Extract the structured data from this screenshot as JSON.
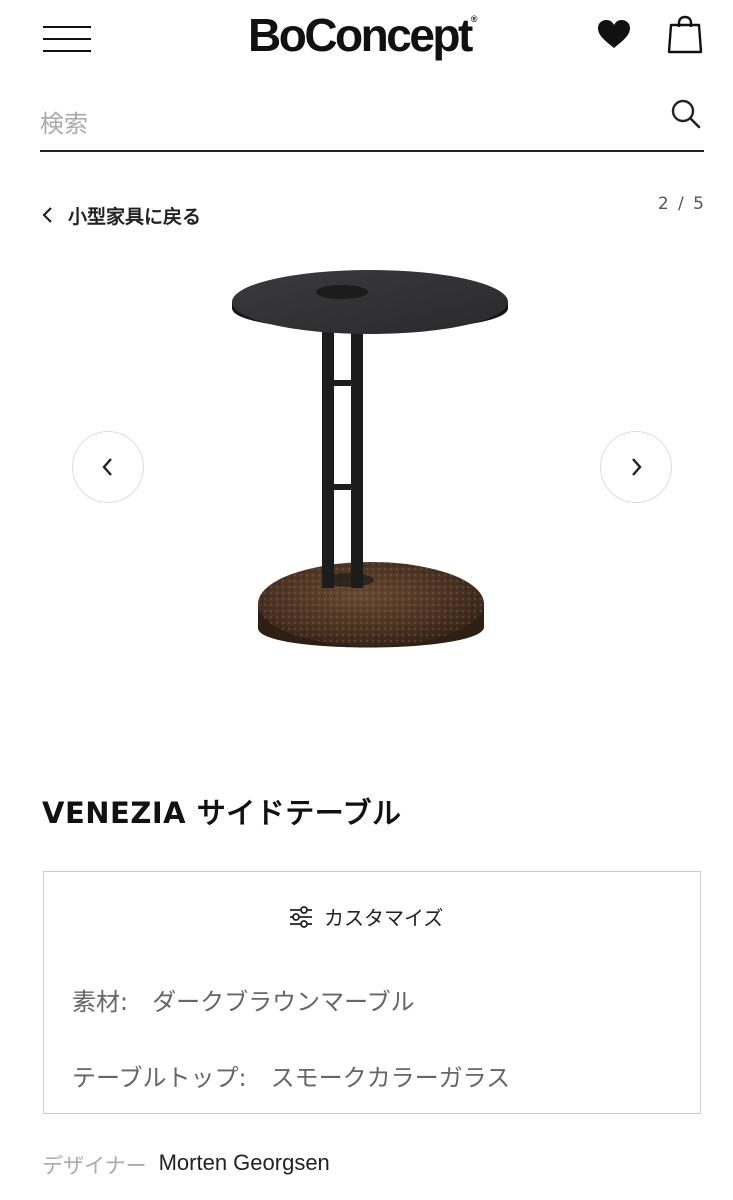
{
  "header": {
    "logo": "BoConcept",
    "logo_mark": "®",
    "menu_icon": "hamburger-menu-icon",
    "favorites_icon": "heart-icon",
    "cart_icon": "shopping-bag-icon"
  },
  "search": {
    "placeholder": "検索",
    "value": "",
    "icon": "search-icon"
  },
  "breadcrumb": {
    "back_label": "小型家具に戻る",
    "icon": "chevron-left-icon"
  },
  "gallery": {
    "counter": "2 / 5",
    "current": 2,
    "total": 5,
    "prev_icon": "chevron-left-icon",
    "next_icon": "chevron-right-icon"
  },
  "product": {
    "title": "VENEZIA サイドテーブル"
  },
  "customize": {
    "label": "カスタマイズ",
    "icon": "sliders-icon",
    "options": [
      {
        "label": "素材:",
        "value": "ダークブラウンマーブル"
      },
      {
        "label": "テーブルトップ:",
        "value": "スモークカラーガラス"
      }
    ]
  },
  "designer": {
    "label": "デザイナー",
    "name": "Morten Georgsen"
  }
}
